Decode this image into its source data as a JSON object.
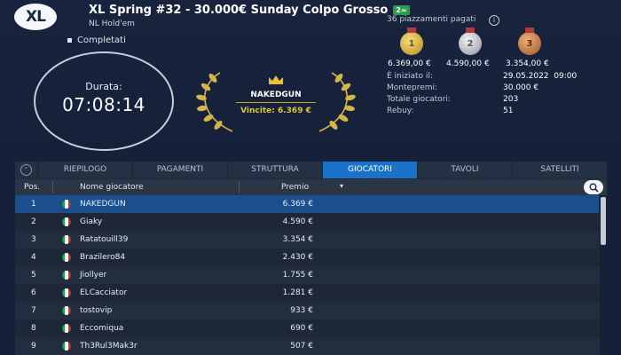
{
  "logo": {
    "text": "XL"
  },
  "header": {
    "title": "XL Spring #32 - 30.000€ Sunday Colpo Grosso",
    "title_badge": "2=",
    "subtitle": "NL Hold'em",
    "status": "Completati"
  },
  "clock": {
    "label": "Durata:",
    "value": "07:08:14"
  },
  "winner": {
    "name": "NAKEDGUN",
    "prize": "Vincite: 6.369 €"
  },
  "payouts": {
    "paid_places": "36 piazzamenti pagati",
    "info_icon": "i",
    "medals": [
      {
        "rank": "1",
        "prize": "6.369,00 €",
        "color": "#d4a93a"
      },
      {
        "rank": "2",
        "prize": "4.590,00 €",
        "color": "#b9bdc4"
      },
      {
        "rank": "3",
        "prize": "3.354,00 €",
        "color": "#c97a44"
      }
    ]
  },
  "details": {
    "labels": [
      "È iniziato il:",
      "Montepremi:",
      "Totale giocatori:",
      "Rebuy:"
    ],
    "values": [
      "29.05.2022  09:00",
      "30.000 €",
      "203",
      "51"
    ]
  },
  "tabs": {
    "toggle_icon": "chevron-up-icon",
    "items": [
      "RIEPILOGO",
      "PAGAMENTI",
      "STRUTTURA",
      "GIOCATORI",
      "TAVOLI",
      "SATELLITI"
    ],
    "active": "GIOCATORI"
  },
  "table": {
    "columns": {
      "pos": "Pos.",
      "name": "Nome giocatore",
      "prize": "Premio",
      "sort_icon": "▾"
    },
    "rows": [
      {
        "pos": "1",
        "name": "NAKEDGUN",
        "prize": "6.369 €"
      },
      {
        "pos": "2",
        "name": "Giaky",
        "prize": "4.590 €"
      },
      {
        "pos": "3",
        "name": "Ratatouill39",
        "prize": "3.354 €"
      },
      {
        "pos": "4",
        "name": "Brazilero84",
        "prize": "2.430 €"
      },
      {
        "pos": "5",
        "name": "Jiollyer",
        "prize": "1.755 €"
      },
      {
        "pos": "6",
        "name": "ELCacciator",
        "prize": "1.281 €"
      },
      {
        "pos": "7",
        "name": "tostovip",
        "prize": "933 €"
      },
      {
        "pos": "8",
        "name": "Eccomiqua",
        "prize": "690 €"
      },
      {
        "pos": "9",
        "name": "Th3Rul3Mak3r",
        "prize": "507 €"
      }
    ],
    "flag_colors": [
      "#1e9e3e",
      "#ffffff",
      "#d02a2a"
    ],
    "selected_row": 0
  },
  "colors": {
    "accent": "#1a73c9",
    "gold": "#e4c234",
    "background": "#15213a"
  }
}
